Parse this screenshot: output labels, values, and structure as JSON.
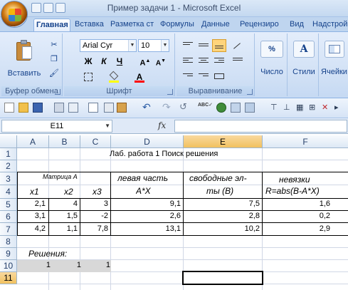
{
  "window": {
    "title": "Пример задачи 1 - Microsoft Excel"
  },
  "tabs": [
    "Главная",
    "Вставка",
    "Разметка ст",
    "Формулы",
    "Данные",
    "Рецензиро",
    "Вид",
    "Надстрой"
  ],
  "ribbon": {
    "clipboard": {
      "paste_label": "Вставить",
      "group_label": "Буфер обмена"
    },
    "font": {
      "name": "Arial Cyr",
      "size": "10",
      "group_label": "Шрифт",
      "bold": "Ж",
      "italic": "К",
      "underline": "Ч",
      "font_color": "#ff0000",
      "fill_color": "#ffff00"
    },
    "alignment": {
      "group_label": "Выравнивание"
    },
    "number": {
      "label": "Число",
      "icon_text": "%"
    },
    "styles": {
      "label": "Стили",
      "icon_text": "A"
    },
    "cells": {
      "label": "Ячейки"
    }
  },
  "formula_bar": {
    "name_box": "E11",
    "fx": "fx",
    "formula": ""
  },
  "columns": [
    "A",
    "B",
    "C",
    "D",
    "E",
    "F"
  ],
  "rows": [
    "1",
    "2",
    "3",
    "4",
    "5",
    "6",
    "7",
    "8",
    "9",
    "10",
    "11"
  ],
  "sheet": {
    "title": "Лаб. работа  1  Поиск решения",
    "matrix_label": "Матрица А",
    "x1": "x1",
    "x2": "x2",
    "x3": "x3",
    "left_part_1": "левая часть",
    "left_part_2": "А*Х",
    "free_1": "свободные эл-",
    "free_2": "ты (В)",
    "resid_1": "невязки",
    "resid_2": "R=abs(B-A*X)",
    "data": [
      [
        "2,1",
        "4",
        "3",
        "9,1",
        "7,5",
        "1,6"
      ],
      [
        "3,1",
        "1,5",
        "-2",
        "2,6",
        "2,8",
        "0,2"
      ],
      [
        "4,2",
        "1,1",
        "7,8",
        "13,1",
        "10,2",
        "2,9"
      ]
    ],
    "solutions_label": "Решения:",
    "solutions": [
      "1",
      "1",
      "1"
    ],
    "selected_cell": "E11"
  }
}
